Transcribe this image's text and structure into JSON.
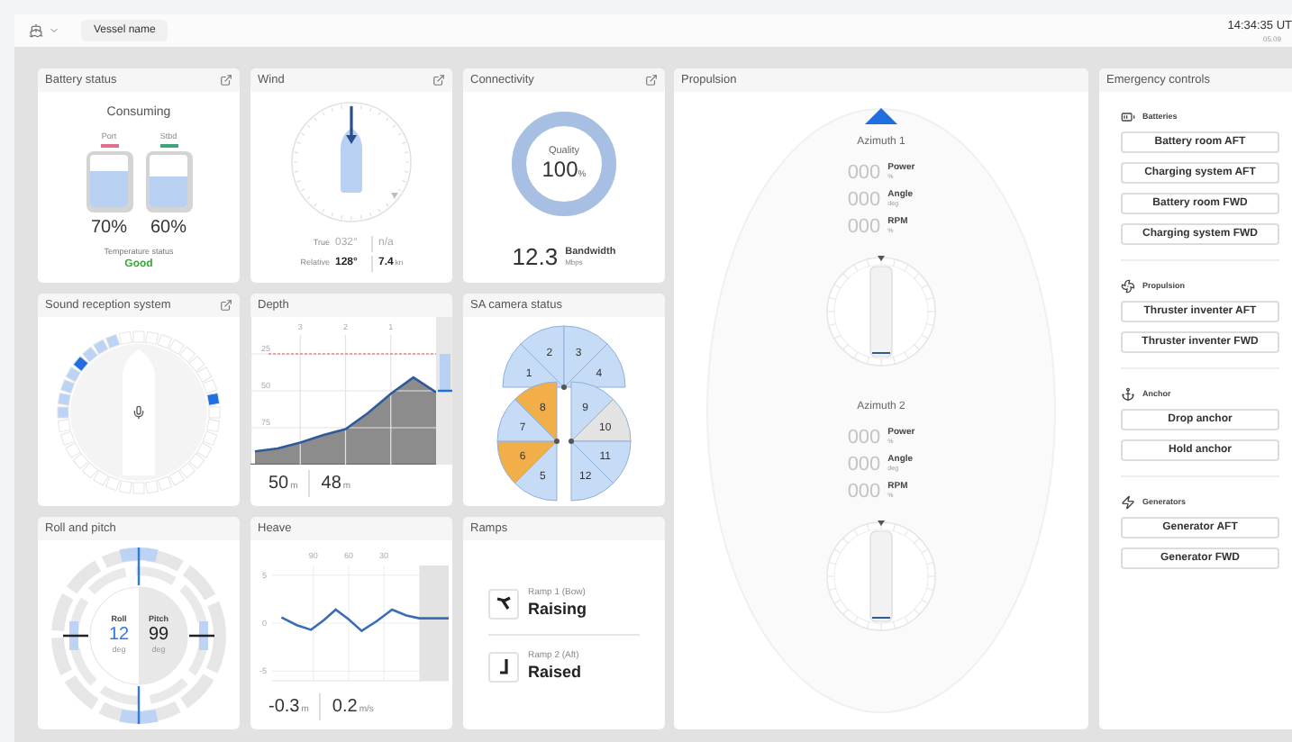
{
  "header": {
    "vessel_name": "Vessel name",
    "time": "14:34:35 UT",
    "date": "05.09"
  },
  "battery": {
    "title": "Battery status",
    "popout": true,
    "mode": "Consuming",
    "packs": [
      {
        "label": "Port",
        "color": "#e0708f",
        "level": 0.7,
        "reading": "70%"
      },
      {
        "label": "Stbd",
        "color": "#3aa67a",
        "level": 0.6,
        "reading": "60%"
      }
    ],
    "temperature_label": "Temperature status",
    "temperature_value": "Good"
  },
  "wind": {
    "title": "Wind",
    "popout": true,
    "rows": [
      {
        "label": "True",
        "direction": "032°",
        "speed": "n/a",
        "dimmed": true
      },
      {
        "label": "Relative",
        "direction": "128°",
        "speed": "7.4",
        "unit": "kn",
        "dimmed": false
      }
    ]
  },
  "connectivity": {
    "title": "Connectivity",
    "popout": true,
    "quality_label": "Quality",
    "quality": "100",
    "quality_unit": "%",
    "level": 1,
    "bandwidth": "12.3",
    "bandwidth_label": "Bandwidth",
    "bandwidth_unit": "Mbps"
  },
  "sound": {
    "title": "Sound reception system",
    "popout": true
  },
  "depth": {
    "title": "Depth",
    "popout": false,
    "chart_data": {
      "type": "line",
      "x": [
        4,
        3.5,
        3,
        2.5,
        2,
        1.5,
        1,
        0.5,
        0
      ],
      "series": [
        {
          "color": "#2f5b9a",
          "values": [
            91,
            89,
            85,
            80,
            76,
            65,
            52,
            41,
            51
          ]
        }
      ],
      "xlim": [
        4.1,
        0
      ],
      "ylim": [
        100,
        0
      ],
      "xticks": [
        3,
        2,
        1
      ],
      "yticks": [
        25,
        50,
        75
      ],
      "grid": true,
      "ref_lines": [
        {
          "axis": "y",
          "value": 25
        }
      ]
    },
    "readings": [
      {
        "value": "50",
        "unit": "m"
      },
      {
        "value": "48",
        "unit": "m"
      }
    ]
  },
  "camera": {
    "title": "SA camera status",
    "popout": false,
    "sectors": [
      {
        "label": "1",
        "color": "#c6dbf6"
      },
      {
        "label": "2",
        "color": "#c6dbf6"
      },
      {
        "label": "3",
        "color": "#c6dbf6"
      },
      {
        "label": "4",
        "color": "#c6dbf6"
      },
      {
        "label": "5",
        "color": "#c6dbf6"
      },
      {
        "label": "6",
        "color": "#f2ae48"
      },
      {
        "label": "7",
        "color": "#c6dbf6"
      },
      {
        "label": "8",
        "color": "#f2ae48"
      },
      {
        "label": "9",
        "color": "#c6dbf6"
      },
      {
        "label": "10",
        "color": "#e3e3e3"
      },
      {
        "label": "11",
        "color": "#c6dbf6"
      },
      {
        "label": "12",
        "color": "#c6dbf6"
      }
    ]
  },
  "roll_pitch": {
    "title": "Roll and pitch",
    "popout": false,
    "roll_label": "Roll",
    "roll": "12",
    "roll_unit": "deg",
    "pitch_label": "Pitch",
    "pitch": "99",
    "pitch_unit": "deg"
  },
  "heave": {
    "title": "Heave",
    "popout": false,
    "chart_data": {
      "type": "line",
      "x": [
        117,
        104,
        92,
        81,
        71,
        60,
        49,
        36,
        23,
        11,
        0,
        -25
      ],
      "series": [
        {
          "color": "#3a6db5",
          "values": [
            0.6,
            -0.2,
            -0.7,
            0.3,
            1.4,
            0.4,
            -0.8,
            0.2,
            1.4,
            0.8,
            0.5,
            0.5
          ]
        }
      ],
      "xlim": [
        125,
        -25
      ],
      "ylim": [
        -6,
        6
      ],
      "xticks": [
        90,
        60,
        30
      ],
      "yticks": [
        5,
        0,
        -5
      ],
      "grid": true,
      "bands": [
        {
          "axis": "x",
          "from": 0,
          "to": -25
        }
      ]
    },
    "readings": [
      {
        "value": "-0.3",
        "unit": "m"
      },
      {
        "value": "0.2",
        "unit": "m/s"
      }
    ]
  },
  "ramps": {
    "title": "Ramps",
    "popout": false,
    "items": [
      {
        "kind": "bow",
        "name": "Ramp 1 (Bow)",
        "status": "Raising"
      },
      {
        "kind": "aft",
        "name": "Ramp 2 (Aft)",
        "status": "Raised"
      }
    ]
  },
  "propulsion": {
    "title": "Propulsion",
    "units": [
      {
        "name": "Azimuth 1",
        "readings": [
          {
            "value": "000",
            "label": "Power",
            "unit": "%"
          },
          {
            "value": "000",
            "label": "Angle",
            "unit": "deg"
          },
          {
            "value": "000",
            "label": "RPM",
            "unit": "%"
          }
        ]
      },
      {
        "name": "Azimuth 2",
        "readings": [
          {
            "value": "000",
            "label": "Power",
            "unit": "%"
          },
          {
            "value": "000",
            "label": "Angle",
            "unit": "deg"
          },
          {
            "value": "000",
            "label": "RPM",
            "unit": "%"
          }
        ]
      }
    ]
  },
  "emergency": {
    "title": "Emergency controls",
    "groups": [
      {
        "kind": "batteries",
        "title": "Batteries",
        "buttons": [
          "Battery room AFT",
          "Charging system AFT",
          "Battery room FWD",
          "Charging system FWD"
        ]
      },
      {
        "kind": "propulsion",
        "title": "Propulsion",
        "buttons": [
          "Thruster inventer AFT",
          "Thruster inventer FWD"
        ]
      },
      {
        "kind": "anchor",
        "title": "Anchor",
        "buttons": [
          "Drop anchor",
          "Hold anchor"
        ]
      },
      {
        "kind": "generators",
        "title": "Generators",
        "buttons": [
          "Generator AFT",
          "Generator FWD"
        ]
      }
    ]
  }
}
